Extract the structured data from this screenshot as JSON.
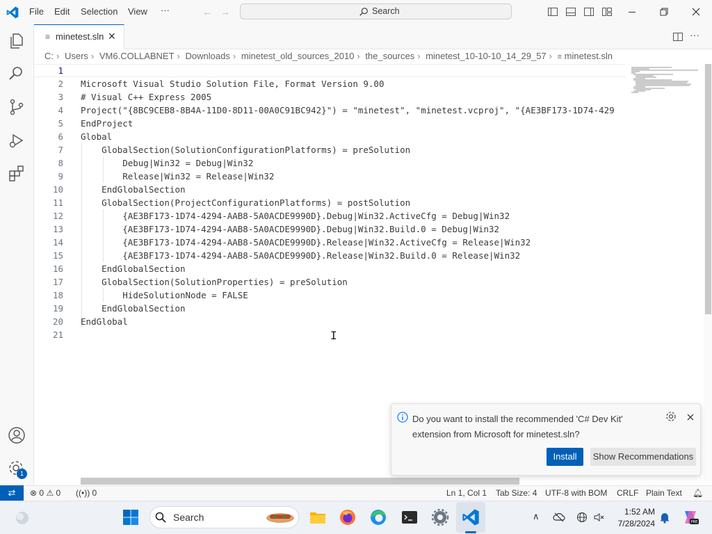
{
  "titlebar": {
    "menu": [
      "File",
      "Edit",
      "Selection",
      "View",
      "···"
    ],
    "search_label": "Search"
  },
  "tab": {
    "label": "minetest.sln",
    "close": "✕"
  },
  "breadcrumb": [
    "C:",
    "Users",
    "VM6.COLLABNET",
    "Downloads",
    "minetest_old_sources_2010",
    "the_sources",
    "minetest_10-10-10_14_29_57",
    "minetest.sln"
  ],
  "editor": {
    "line_numbers": [
      "1",
      "2",
      "3",
      "4",
      "5",
      "6",
      "7",
      "8",
      "9",
      "10",
      "11",
      "12",
      "13",
      "14",
      "15",
      "16",
      "17",
      "18",
      "19",
      "20",
      "21"
    ],
    "lines": [
      "",
      "Microsoft Visual Studio Solution File, Format Version 9.00",
      "# Visual C++ Express 2005",
      "Project(\"{8BC9CEB8-8B4A-11D0-8D11-00A0C91BC942}\") = \"minetest\", \"minetest.vcproj\", \"{AE3BF173-1D74-429",
      "EndProject",
      "Global",
      "    GlobalSection(SolutionConfigurationPlatforms) = preSolution",
      "        Debug|Win32 = Debug|Win32",
      "        Release|Win32 = Release|Win32",
      "    EndGlobalSection",
      "    GlobalSection(ProjectConfigurationPlatforms) = postSolution",
      "        {AE3BF173-1D74-4294-AAB8-5A0ACDE9990D}.Debug|Win32.ActiveCfg = Debug|Win32",
      "        {AE3BF173-1D74-4294-AAB8-5A0ACDE9990D}.Debug|Win32.Build.0 = Debug|Win32",
      "        {AE3BF173-1D74-4294-AAB8-5A0ACDE9990D}.Release|Win32.ActiveCfg = Release|Win32",
      "        {AE3BF173-1D74-4294-AAB8-5A0ACDE9990D}.Release|Win32.Build.0 = Release|Win32",
      "    EndGlobalSection",
      "    GlobalSection(SolutionProperties) = preSolution",
      "        HideSolutionNode = FALSE",
      "    EndGlobalSection",
      "EndGlobal",
      ""
    ]
  },
  "notification": {
    "message": "Do you want to install the recommended 'C# Dev Kit' extension from Microsoft for minetest.sln?",
    "install_label": "Install",
    "show_recommendations_label": "Show Recommendations"
  },
  "activity": {
    "accounts_badge": "1"
  },
  "statusbar": {
    "errors": "0",
    "warnings": "0",
    "ports": "0",
    "position": "Ln 1, Col 1",
    "tab_size": "Tab Size: 4",
    "encoding": "UTF-8 with BOM",
    "eol": "CRLF",
    "language": "Plain Text"
  },
  "taskbar": {
    "search_label": "Search",
    "time": "1:52 AM",
    "date": "7/28/2024"
  },
  "colors": {
    "accent": "#005fb8",
    "status_bg": "#f8f8f8"
  }
}
